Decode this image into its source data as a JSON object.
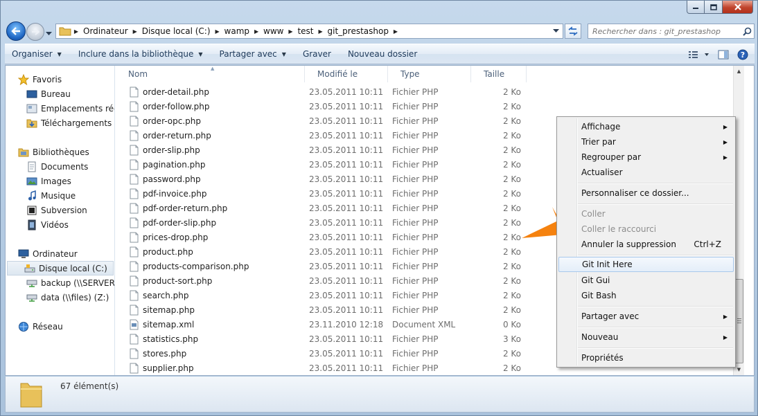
{
  "window": {
    "minimize_label": "",
    "maximize_label": "",
    "close_label": ""
  },
  "address": {
    "crumbs": [
      "Ordinateur",
      "Disque local (C:)",
      "wamp",
      "www",
      "test",
      "git_prestashop"
    ]
  },
  "search": {
    "placeholder": "Rechercher dans : git_prestashop"
  },
  "toolbar": {
    "organize": "Organiser",
    "include": "Inclure dans la bibliothèque",
    "share": "Partager avec",
    "burn": "Graver",
    "new_folder": "Nouveau dossier"
  },
  "nav": {
    "favorites": "Favoris",
    "desktop": "Bureau",
    "recent": "Emplacements récents",
    "downloads": "Téléchargements",
    "libraries": "Bibliothèques",
    "documents": "Documents",
    "images": "Images",
    "music": "Musique",
    "subversion": "Subversion",
    "videos": "Vidéos",
    "computer": "Ordinateur",
    "local_disk": "Disque local (C:)",
    "backup": "backup (\\\\SERVER-N",
    "data": "data (\\\\files) (Z:)",
    "network": "Réseau"
  },
  "columns": {
    "name": "Nom",
    "modified": "Modifié le",
    "type": "Type",
    "size": "Taille"
  },
  "files": [
    {
      "name": "order-detail.php",
      "date": "23.05.2011 10:11",
      "type": "Fichier PHP",
      "size": "2 Ko"
    },
    {
      "name": "order-follow.php",
      "date": "23.05.2011 10:11",
      "type": "Fichier PHP",
      "size": "2 Ko"
    },
    {
      "name": "order-opc.php",
      "date": "23.05.2011 10:11",
      "type": "Fichier PHP",
      "size": "2 Ko"
    },
    {
      "name": "order-return.php",
      "date": "23.05.2011 10:11",
      "type": "Fichier PHP",
      "size": "2 Ko"
    },
    {
      "name": "order-slip.php",
      "date": "23.05.2011 10:11",
      "type": "Fichier PHP",
      "size": "2 Ko"
    },
    {
      "name": "pagination.php",
      "date": "23.05.2011 10:11",
      "type": "Fichier PHP",
      "size": "2 Ko"
    },
    {
      "name": "password.php",
      "date": "23.05.2011 10:11",
      "type": "Fichier PHP",
      "size": "2 Ko"
    },
    {
      "name": "pdf-invoice.php",
      "date": "23.05.2011 10:11",
      "type": "Fichier PHP",
      "size": "2 Ko"
    },
    {
      "name": "pdf-order-return.php",
      "date": "23.05.2011 10:11",
      "type": "Fichier PHP",
      "size": "2 Ko"
    },
    {
      "name": "pdf-order-slip.php",
      "date": "23.05.2011 10:11",
      "type": "Fichier PHP",
      "size": "2 Ko"
    },
    {
      "name": "prices-drop.php",
      "date": "23.05.2011 10:11",
      "type": "Fichier PHP",
      "size": "2 Ko"
    },
    {
      "name": "product.php",
      "date": "23.05.2011 10:11",
      "type": "Fichier PHP",
      "size": "2 Ko"
    },
    {
      "name": "products-comparison.php",
      "date": "23.05.2011 10:11",
      "type": "Fichier PHP",
      "size": "2 Ko"
    },
    {
      "name": "product-sort.php",
      "date": "23.05.2011 10:11",
      "type": "Fichier PHP",
      "size": "2 Ko"
    },
    {
      "name": "search.php",
      "date": "23.05.2011 10:11",
      "type": "Fichier PHP",
      "size": "2 Ko"
    },
    {
      "name": "sitemap.php",
      "date": "23.05.2011 10:11",
      "type": "Fichier PHP",
      "size": "2 Ko"
    },
    {
      "name": "sitemap.xml",
      "date": "23.11.2010 12:18",
      "type": "Document XML",
      "size": "0 Ko"
    },
    {
      "name": "statistics.php",
      "date": "23.05.2011 10:11",
      "type": "Fichier PHP",
      "size": "3 Ko"
    },
    {
      "name": "stores.php",
      "date": "23.05.2011 10:11",
      "type": "Fichier PHP",
      "size": "2 Ko"
    },
    {
      "name": "supplier.php",
      "date": "23.05.2011 10:11",
      "type": "Fichier PHP",
      "size": "2 Ko"
    }
  ],
  "status": {
    "count": "67 élément(s)"
  },
  "context_menu": {
    "view": "Affichage",
    "sort_by": "Trier par",
    "group_by": "Regrouper par",
    "refresh": "Actualiser",
    "customize": "Personnaliser ce dossier...",
    "paste": "Coller",
    "paste_shortcut": "Coller le raccourci",
    "undo_delete": "Annuler la suppression",
    "undo_shortcut": "Ctrl+Z",
    "git_init": "Git Init Here",
    "git_gui": "Git Gui",
    "git_bash": "Git Bash",
    "share_with": "Partager avec",
    "new": "Nouveau",
    "properties": "Propriétés"
  },
  "colors": {
    "accent_arrow": "#f5820f",
    "selection": "#dde7f1"
  }
}
